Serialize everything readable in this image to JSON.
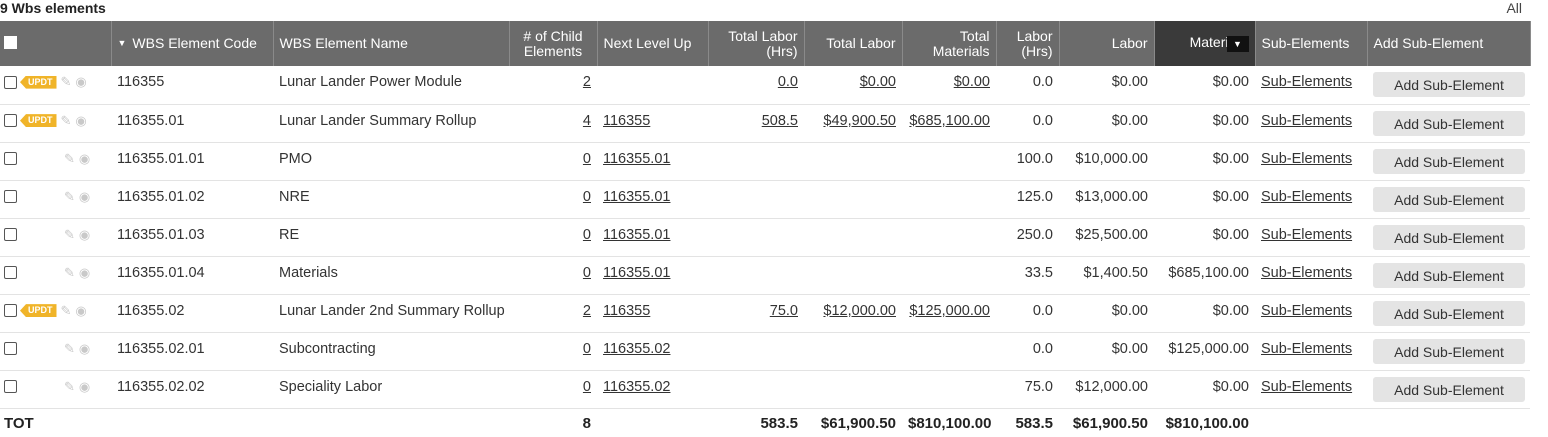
{
  "header": {
    "count_title": "9 Wbs elements",
    "all_link": "All"
  },
  "columns": {
    "code": "WBS Element Code",
    "name": "WBS Element Name",
    "child": "# of Child Elements",
    "next_level": "Next Level Up",
    "total_labor_hrs": "Total Labor (Hrs)",
    "total_labor": "Total Labor",
    "total_materials": "Total Materials",
    "labor_hrs": "Labor (Hrs)",
    "labor": "Labor",
    "materials": "Materi",
    "sub_elements": "Sub-Elements",
    "add_sub": "Add Sub-Element"
  },
  "badge_label": "UPDT",
  "rows": [
    {
      "badge": "UPDT",
      "code": "116355",
      "name": "Lunar Lander Power Module",
      "child": "2",
      "next": "",
      "tl_hrs": "0.0",
      "tl": "$0.00",
      "tm": "$0.00",
      "l_hrs": "0.0",
      "labor": "$0.00",
      "mat": "$0.00",
      "sub": "Sub-Elements",
      "add": "Add Sub-Element"
    },
    {
      "badge": "UPDT",
      "code": "116355.01",
      "name": "Lunar Lander Summary Rollup",
      "child": "4",
      "next": "116355",
      "tl_hrs": "508.5",
      "tl": "$49,900.50",
      "tm": "$685,100.00",
      "l_hrs": "0.0",
      "labor": "$0.00",
      "mat": "$0.00",
      "sub": "Sub-Elements",
      "add": "Add Sub-Element"
    },
    {
      "badge": "",
      "code": "116355.01.01",
      "name": "PMO",
      "child": "0",
      "next": "116355.01",
      "tl_hrs": "",
      "tl": "",
      "tm": "",
      "l_hrs": "100.0",
      "labor": "$10,000.00",
      "mat": "$0.00",
      "sub": "Sub-Elements",
      "add": "Add Sub-Element"
    },
    {
      "badge": "",
      "code": "116355.01.02",
      "name": "NRE",
      "child": "0",
      "next": "116355.01",
      "tl_hrs": "",
      "tl": "",
      "tm": "",
      "l_hrs": "125.0",
      "labor": "$13,000.00",
      "mat": "$0.00",
      "sub": "Sub-Elements",
      "add": "Add Sub-Element"
    },
    {
      "badge": "",
      "code": "116355.01.03",
      "name": "RE",
      "child": "0",
      "next": "116355.01",
      "tl_hrs": "",
      "tl": "",
      "tm": "",
      "l_hrs": "250.0",
      "labor": "$25,500.00",
      "mat": "$0.00",
      "sub": "Sub-Elements",
      "add": "Add Sub-Element"
    },
    {
      "badge": "",
      "code": "116355.01.04",
      "name": "Materials",
      "child": "0",
      "next": "116355.01",
      "tl_hrs": "",
      "tl": "",
      "tm": "",
      "l_hrs": "33.5",
      "labor": "$1,400.50",
      "mat": "$685,100.00",
      "sub": "Sub-Elements",
      "add": "Add Sub-Element"
    },
    {
      "badge": "UPDT",
      "code": "116355.02",
      "name": "Lunar Lander 2nd Summary Rollup",
      "child": "2",
      "next": "116355",
      "tl_hrs": "75.0",
      "tl": "$12,000.00",
      "tm": "$125,000.00",
      "l_hrs": "0.0",
      "labor": "$0.00",
      "mat": "$0.00",
      "sub": "Sub-Elements",
      "add": "Add Sub-Element"
    },
    {
      "badge": "",
      "code": "116355.02.01",
      "name": "Subcontracting",
      "child": "0",
      "next": "116355.02",
      "tl_hrs": "",
      "tl": "",
      "tm": "",
      "l_hrs": "0.0",
      "labor": "$0.00",
      "mat": "$125,000.00",
      "sub": "Sub-Elements",
      "add": "Add Sub-Element"
    },
    {
      "badge": "",
      "code": "116355.02.02",
      "name": "Speciality Labor",
      "child": "0",
      "next": "116355.02",
      "tl_hrs": "",
      "tl": "",
      "tm": "",
      "l_hrs": "75.0",
      "labor": "$12,000.00",
      "mat": "$0.00",
      "sub": "Sub-Elements",
      "add": "Add Sub-Element"
    }
  ],
  "totals": {
    "label": "TOT",
    "child": "8",
    "tl_hrs": "583.5",
    "tl": "$61,900.50",
    "tm": "$810,100.00",
    "l_hrs": "583.5",
    "labor": "$61,900.50",
    "mat": "$810,100.00"
  }
}
